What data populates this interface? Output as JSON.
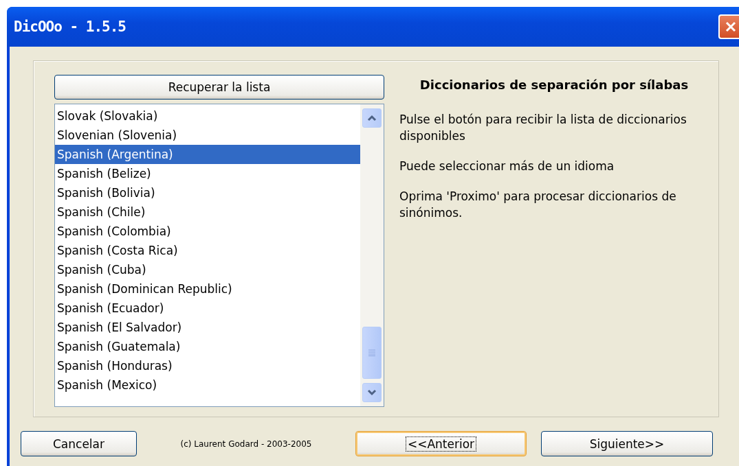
{
  "window": {
    "title": "DicOOo - 1.5.5"
  },
  "fetch_button": "Recuperar la lista",
  "languages": [
    {
      "label": "Slovak (Slovakia)",
      "selected": false
    },
    {
      "label": "Slovenian (Slovenia)",
      "selected": false
    },
    {
      "label": "Spanish (Argentina)",
      "selected": true
    },
    {
      "label": "Spanish (Belize)",
      "selected": false
    },
    {
      "label": "Spanish (Bolivia)",
      "selected": false
    },
    {
      "label": "Spanish (Chile)",
      "selected": false
    },
    {
      "label": "Spanish (Colombia)",
      "selected": false
    },
    {
      "label": "Spanish (Costa Rica)",
      "selected": false
    },
    {
      "label": "Spanish (Cuba)",
      "selected": false
    },
    {
      "label": "Spanish (Dominican Republic)",
      "selected": false
    },
    {
      "label": "Spanish (Ecuador)",
      "selected": false
    },
    {
      "label": "Spanish (El Salvador)",
      "selected": false
    },
    {
      "label": "Spanish (Guatemala)",
      "selected": false
    },
    {
      "label": "Spanish (Honduras)",
      "selected": false
    },
    {
      "label": "Spanish (Mexico)",
      "selected": false
    }
  ],
  "info": {
    "heading": "Diccionarios de separación por sílabas",
    "paragraphs": [
      "Pulse el botón para recibir la lista de diccionarios disponibles",
      "Puede seleccionar más de un idioma",
      "Oprima 'Proximo' para procesar diccionarios de sinónimos."
    ]
  },
  "footer": {
    "cancel": "Cancelar",
    "copyright": "(c) Laurent Godard - 2003-2005",
    "back": "<<Anterior",
    "next": "Siguiente>>"
  }
}
